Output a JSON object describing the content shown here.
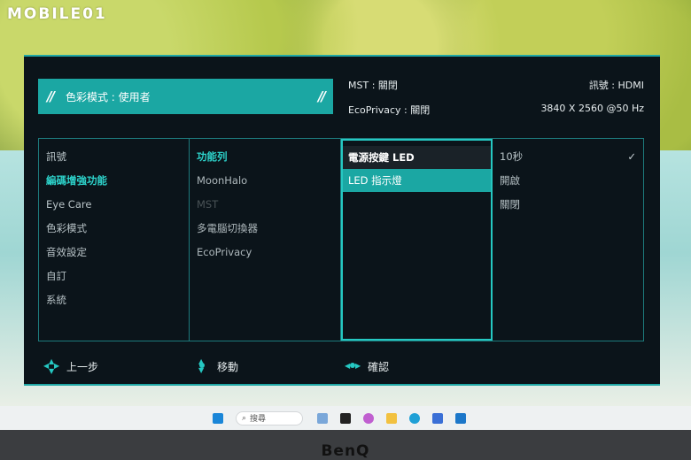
{
  "watermark": "MOBILE01",
  "osd": {
    "mode_banner": {
      "left_glyph": "//",
      "label": "色彩模式 : 使用者",
      "right_glyph": "//"
    },
    "info": {
      "mst": "MST : 關閉",
      "ecoprivacy": "EcoPrivacy : 關閉",
      "signal": "訊號 : HDMI",
      "resolution": "3840 X 2560 @50 Hz"
    },
    "menu": {
      "col1": [
        "訊號",
        "編碼增強功能",
        "Eye Care",
        "色彩模式",
        "音效設定",
        "自訂",
        "系統"
      ],
      "col1_active_index": 1,
      "col2": [
        "功能列",
        "MoonHalo",
        "MST",
        "多電腦切換器",
        "EcoPrivacy"
      ],
      "col2_active_index": 0,
      "col2_disabled_index": 2,
      "col3": [
        "電源按鍵 LED",
        "LED 指示燈"
      ],
      "col3_selected_index": 1,
      "col4": [
        "10秒",
        "開啟",
        "關閉"
      ],
      "col4_checked_index": 0
    },
    "footer": {
      "back": "上一步",
      "move": "移動",
      "confirm": "確認"
    }
  },
  "taskbar": {
    "search_placeholder": "搜尋",
    "icons": [
      "windows-start-icon",
      "search-icon",
      "widgets-icon",
      "file-explorer-icon",
      "copilot-icon",
      "folder-icon",
      "edge-icon",
      "store-icon",
      "outlook-icon"
    ]
  },
  "bezel": {
    "brand": "BenQ"
  },
  "colors": {
    "accent": "#1ba7a3",
    "panel": "#0b141a",
    "highlight_border": "#25c8c2"
  }
}
